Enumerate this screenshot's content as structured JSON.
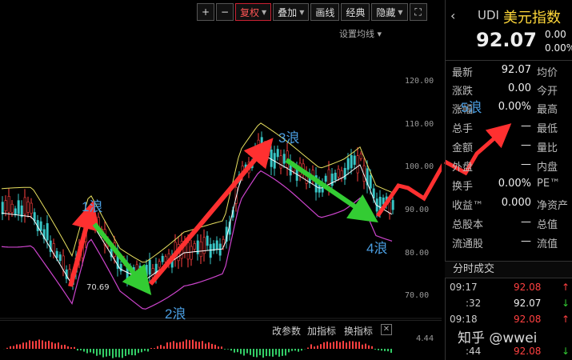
{
  "toolbar": {
    "plus": "+",
    "minus": "−",
    "adjust": "复权",
    "overlay": "叠加",
    "draw": "画线",
    "classic": "经典",
    "hide": "隐藏",
    "fullscreen": "⛶"
  },
  "chart": {
    "setting_label": "设置均线",
    "price_ticks": [
      "120.00",
      "110.00",
      "100.00",
      "90.00",
      "80.00",
      "70.00"
    ],
    "low_label": "70.69",
    "waves": [
      "1浪",
      "2浪",
      "3浪",
      "4浪",
      "5浪"
    ],
    "colors": {
      "up_arrow": "#ff3030",
      "down_arrow": "#33cc33",
      "upper_band": "#e8e060",
      "lower_band": "#cc44cc",
      "mid_band": "#ffffff"
    }
  },
  "bottom": {
    "param": "改参数",
    "add_ind": "加指标",
    "switch_ind": "换指标",
    "close": "✕",
    "value": "4.44"
  },
  "quote": {
    "code": "UDI",
    "name": "美元指数",
    "price": "92.07",
    "change": "0.00",
    "change_pct": "0.00%",
    "rows": [
      {
        "k": "最新",
        "v": "92.07",
        "k2": "均价"
      },
      {
        "k": "涨跌",
        "v": "0.00",
        "k2": "今开"
      },
      {
        "k": "涨幅",
        "v": "0.00%",
        "k2": "最高"
      },
      {
        "k": "总手",
        "v": "—",
        "k2": "最低"
      },
      {
        "k": "金额",
        "v": "—",
        "k2": "量比"
      },
      {
        "k": "外盘",
        "v": "—",
        "k2": "内盘"
      },
      {
        "k": "换手",
        "v": "0.00%",
        "k2": "PE™"
      },
      {
        "k": "收益™",
        "v": "0.000",
        "k2": "净资产"
      },
      {
        "k": "总股本",
        "v": "—",
        "k2": "总值"
      },
      {
        "k": "流通股",
        "v": "—",
        "k2": "流值"
      }
    ],
    "ticks_title": "分时成交",
    "ticks": [
      {
        "time": "09:17",
        "price": "92.08",
        "dir": "↑"
      },
      {
        "time": ":32",
        "price": "92.07",
        "dir": "↓"
      },
      {
        "time": "09:18",
        "price": "92.08",
        "dir": "↑"
      },
      {
        "time": ":44",
        "price": "92.08",
        "dir": "↓"
      }
    ]
  },
  "watermark": "知乎 @wwei"
}
